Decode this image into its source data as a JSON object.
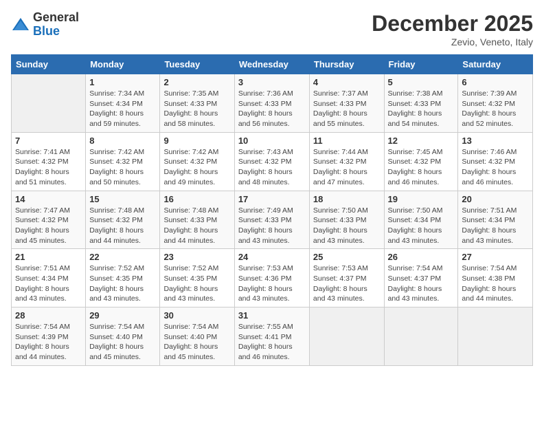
{
  "header": {
    "logo_general": "General",
    "logo_blue": "Blue",
    "month_title": "December 2025",
    "location": "Zevio, Veneto, Italy"
  },
  "days_of_week": [
    "Sunday",
    "Monday",
    "Tuesday",
    "Wednesday",
    "Thursday",
    "Friday",
    "Saturday"
  ],
  "weeks": [
    [
      {
        "day": "",
        "info": ""
      },
      {
        "day": "1",
        "info": "Sunrise: 7:34 AM\nSunset: 4:34 PM\nDaylight: 8 hours\nand 59 minutes."
      },
      {
        "day": "2",
        "info": "Sunrise: 7:35 AM\nSunset: 4:33 PM\nDaylight: 8 hours\nand 58 minutes."
      },
      {
        "day": "3",
        "info": "Sunrise: 7:36 AM\nSunset: 4:33 PM\nDaylight: 8 hours\nand 56 minutes."
      },
      {
        "day": "4",
        "info": "Sunrise: 7:37 AM\nSunset: 4:33 PM\nDaylight: 8 hours\nand 55 minutes."
      },
      {
        "day": "5",
        "info": "Sunrise: 7:38 AM\nSunset: 4:33 PM\nDaylight: 8 hours\nand 54 minutes."
      },
      {
        "day": "6",
        "info": "Sunrise: 7:39 AM\nSunset: 4:32 PM\nDaylight: 8 hours\nand 52 minutes."
      }
    ],
    [
      {
        "day": "7",
        "info": "Sunrise: 7:41 AM\nSunset: 4:32 PM\nDaylight: 8 hours\nand 51 minutes."
      },
      {
        "day": "8",
        "info": "Sunrise: 7:42 AM\nSunset: 4:32 PM\nDaylight: 8 hours\nand 50 minutes."
      },
      {
        "day": "9",
        "info": "Sunrise: 7:42 AM\nSunset: 4:32 PM\nDaylight: 8 hours\nand 49 minutes."
      },
      {
        "day": "10",
        "info": "Sunrise: 7:43 AM\nSunset: 4:32 PM\nDaylight: 8 hours\nand 48 minutes."
      },
      {
        "day": "11",
        "info": "Sunrise: 7:44 AM\nSunset: 4:32 PM\nDaylight: 8 hours\nand 47 minutes."
      },
      {
        "day": "12",
        "info": "Sunrise: 7:45 AM\nSunset: 4:32 PM\nDaylight: 8 hours\nand 46 minutes."
      },
      {
        "day": "13",
        "info": "Sunrise: 7:46 AM\nSunset: 4:32 PM\nDaylight: 8 hours\nand 46 minutes."
      }
    ],
    [
      {
        "day": "14",
        "info": "Sunrise: 7:47 AM\nSunset: 4:32 PM\nDaylight: 8 hours\nand 45 minutes."
      },
      {
        "day": "15",
        "info": "Sunrise: 7:48 AM\nSunset: 4:32 PM\nDaylight: 8 hours\nand 44 minutes."
      },
      {
        "day": "16",
        "info": "Sunrise: 7:48 AM\nSunset: 4:33 PM\nDaylight: 8 hours\nand 44 minutes."
      },
      {
        "day": "17",
        "info": "Sunrise: 7:49 AM\nSunset: 4:33 PM\nDaylight: 8 hours\nand 43 minutes."
      },
      {
        "day": "18",
        "info": "Sunrise: 7:50 AM\nSunset: 4:33 PM\nDaylight: 8 hours\nand 43 minutes."
      },
      {
        "day": "19",
        "info": "Sunrise: 7:50 AM\nSunset: 4:34 PM\nDaylight: 8 hours\nand 43 minutes."
      },
      {
        "day": "20",
        "info": "Sunrise: 7:51 AM\nSunset: 4:34 PM\nDaylight: 8 hours\nand 43 minutes."
      }
    ],
    [
      {
        "day": "21",
        "info": "Sunrise: 7:51 AM\nSunset: 4:34 PM\nDaylight: 8 hours\nand 43 minutes."
      },
      {
        "day": "22",
        "info": "Sunrise: 7:52 AM\nSunset: 4:35 PM\nDaylight: 8 hours\nand 43 minutes."
      },
      {
        "day": "23",
        "info": "Sunrise: 7:52 AM\nSunset: 4:35 PM\nDaylight: 8 hours\nand 43 minutes."
      },
      {
        "day": "24",
        "info": "Sunrise: 7:53 AM\nSunset: 4:36 PM\nDaylight: 8 hours\nand 43 minutes."
      },
      {
        "day": "25",
        "info": "Sunrise: 7:53 AM\nSunset: 4:37 PM\nDaylight: 8 hours\nand 43 minutes."
      },
      {
        "day": "26",
        "info": "Sunrise: 7:54 AM\nSunset: 4:37 PM\nDaylight: 8 hours\nand 43 minutes."
      },
      {
        "day": "27",
        "info": "Sunrise: 7:54 AM\nSunset: 4:38 PM\nDaylight: 8 hours\nand 44 minutes."
      }
    ],
    [
      {
        "day": "28",
        "info": "Sunrise: 7:54 AM\nSunset: 4:39 PM\nDaylight: 8 hours\nand 44 minutes."
      },
      {
        "day": "29",
        "info": "Sunrise: 7:54 AM\nSunset: 4:40 PM\nDaylight: 8 hours\nand 45 minutes."
      },
      {
        "day": "30",
        "info": "Sunrise: 7:54 AM\nSunset: 4:40 PM\nDaylight: 8 hours\nand 45 minutes."
      },
      {
        "day": "31",
        "info": "Sunrise: 7:55 AM\nSunset: 4:41 PM\nDaylight: 8 hours\nand 46 minutes."
      },
      {
        "day": "",
        "info": ""
      },
      {
        "day": "",
        "info": ""
      },
      {
        "day": "",
        "info": ""
      }
    ]
  ]
}
